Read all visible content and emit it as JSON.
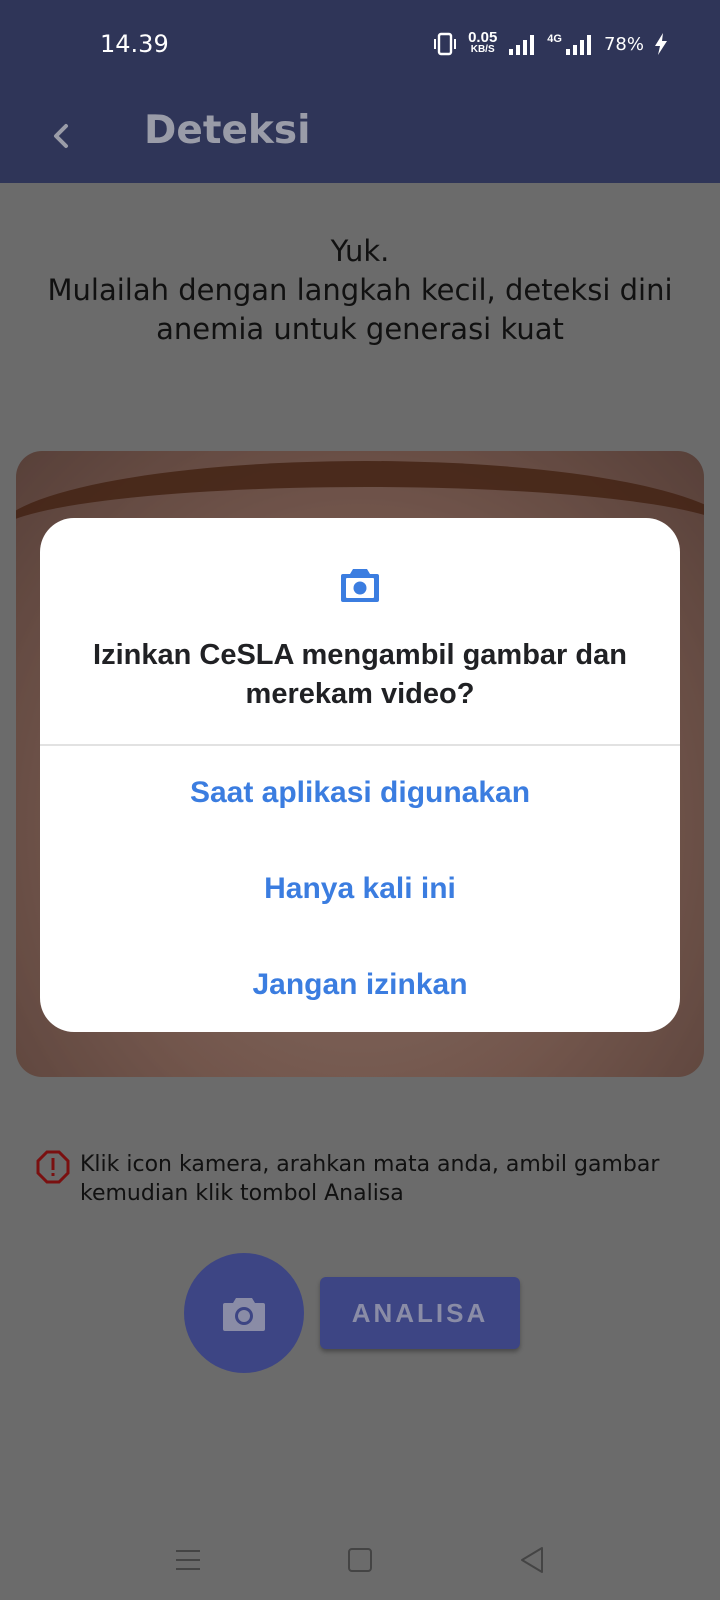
{
  "status_bar": {
    "time": "14.39",
    "speed_value": "0.05",
    "speed_unit": "KB/S",
    "network": "4G",
    "battery": "78%"
  },
  "app_bar": {
    "back_icon": "chevron-left-icon",
    "title": "Deteksi"
  },
  "intro": {
    "line1": "Yuk.",
    "line2": "Mulailah dengan langkah kecil, deteksi dini anemia untuk generasi kuat"
  },
  "hint": {
    "icon": "alert-octagon-icon",
    "text": "Klik icon kamera, arahkan mata anda, ambil gambar kemudian klik tombol Analisa"
  },
  "actions": {
    "camera_icon": "camera-icon",
    "analisa_label": "ANALISA"
  },
  "dialog": {
    "icon": "camera-icon",
    "title": "Izinkan CeSLA mengambil gambar dan merekam video?",
    "options": [
      "Saat aplikasi digunakan",
      "Hanya kali ini",
      "Jangan izinkan"
    ]
  },
  "colors": {
    "header_bg": "#2f3558",
    "button_bg": "#3d4584",
    "dialog_accent": "#3b7de0",
    "hint_icon": "#c0161c"
  }
}
